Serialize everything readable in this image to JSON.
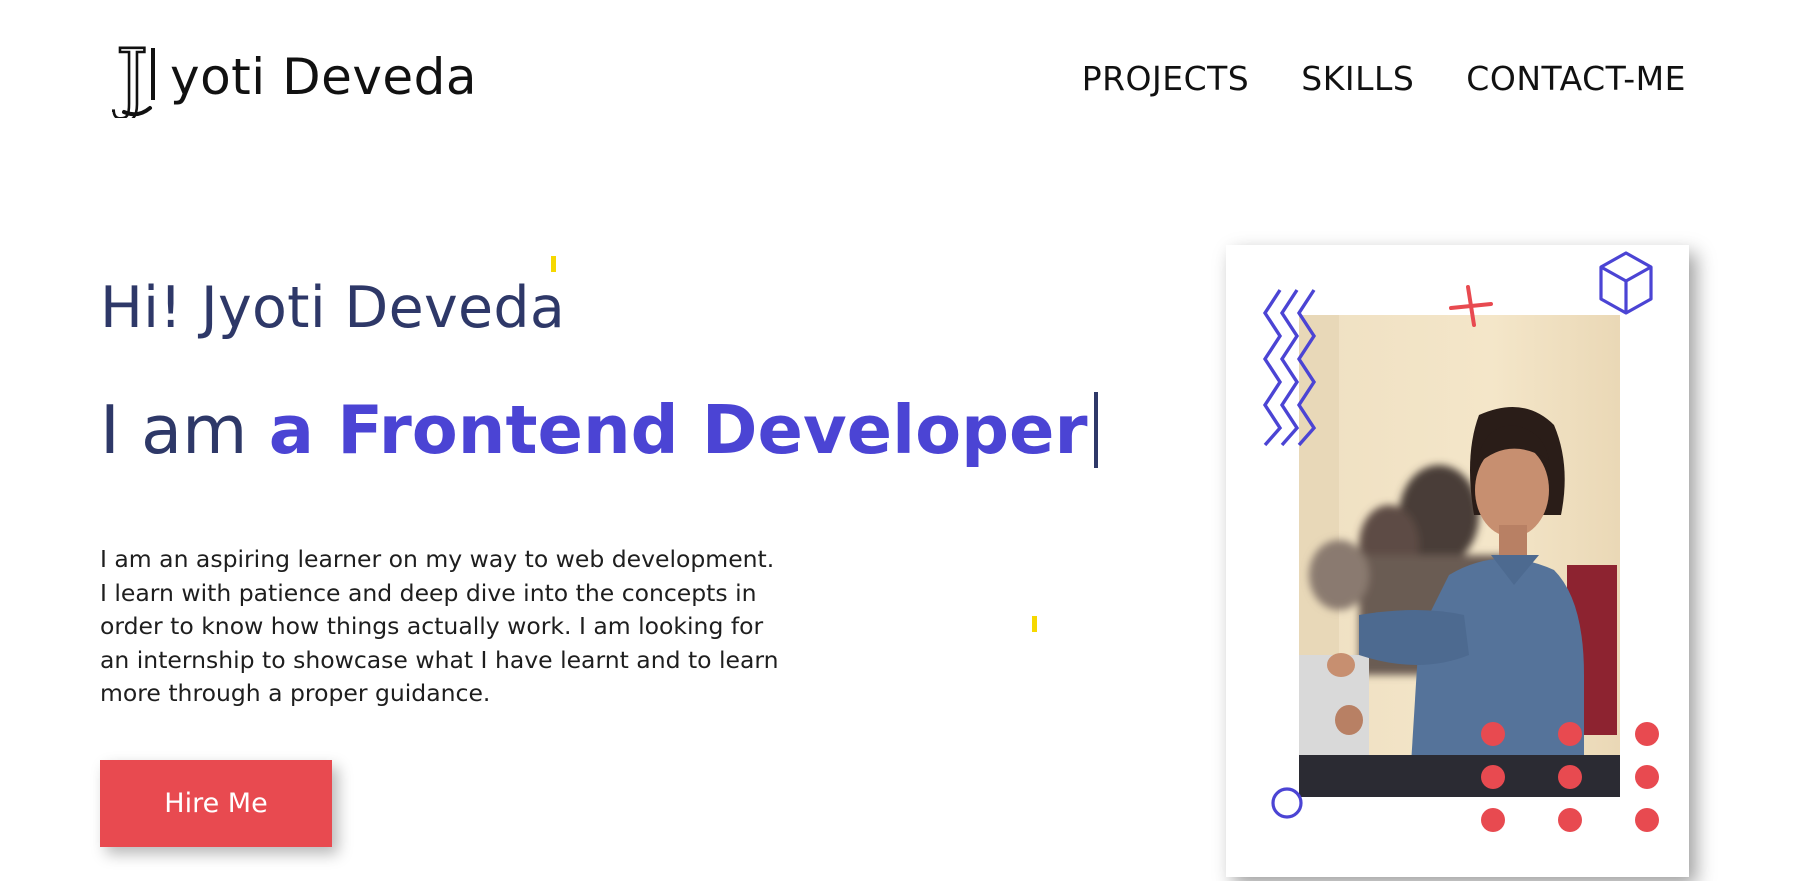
{
  "header": {
    "logo_initial": "J",
    "logo_rest": "yoti Deveda",
    "nav": [
      "PROJECTS",
      "SKILLS",
      "CONTACT-ME"
    ]
  },
  "hero": {
    "greeting": "Hi! Jyoti Deveda",
    "role_lead": "I am ",
    "role_highlight": "a Frontend Developer",
    "bio_lines": [
      "I am an aspiring learner on my way to web development.",
      "I learn with patience and deep dive into the concepts in",
      "order to know how things actually work. I am looking for",
      "an internship to showcase what I have learnt and to learn",
      "more through a proper guidance."
    ],
    "cta_label": "Hire Me"
  },
  "icons": {
    "zigzag": "zigzag-icon",
    "plus": "plus-icon",
    "cube": "cube-icon",
    "circle": "circle-outline-icon",
    "dots": "dot-grid-icon"
  },
  "colors": {
    "accent": "#4b44d4",
    "heading": "#2e3868",
    "cta": "#e84a50",
    "spark": "#f6d800"
  }
}
